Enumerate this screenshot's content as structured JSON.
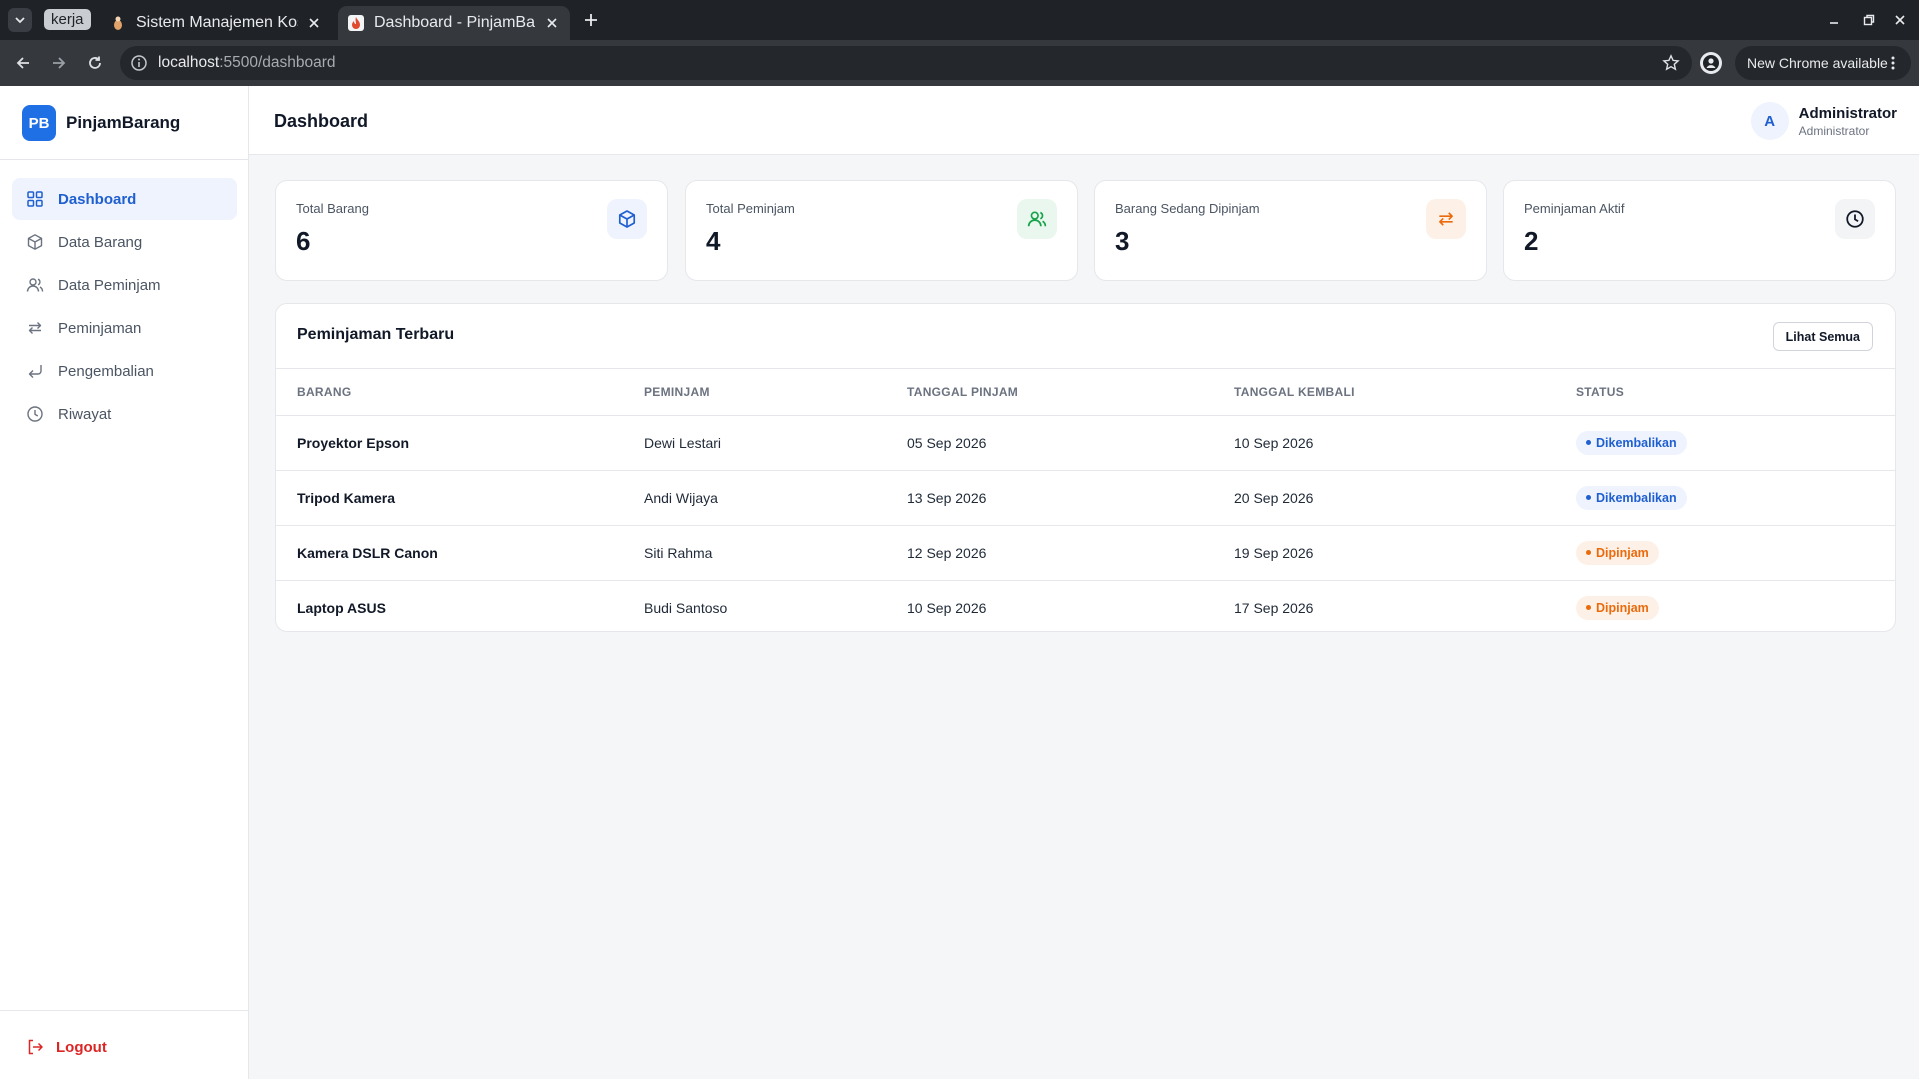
{
  "browser": {
    "group_label": "kerja",
    "tabs": [
      {
        "title": "Sistem Manajemen Kos"
      },
      {
        "title": "Dashboard - PinjamBarang"
      }
    ],
    "url_host": "localhost",
    "url_path": ":5500/dashboard",
    "update_label": "New Chrome available"
  },
  "app": {
    "logo_text": "PB",
    "name": "PinjamBarang"
  },
  "sidebar": {
    "items": [
      {
        "label": "Dashboard",
        "icon": "grid-icon",
        "active": true
      },
      {
        "label": "Data Barang",
        "icon": "box-icon"
      },
      {
        "label": "Data Peminjam",
        "icon": "users-icon"
      },
      {
        "label": "Peminjaman",
        "icon": "swap-icon"
      },
      {
        "label": "Pengembalian",
        "icon": "return-icon"
      },
      {
        "label": "Riwayat",
        "icon": "clock-icon"
      }
    ],
    "logout_label": "Logout"
  },
  "header": {
    "title": "Dashboard",
    "user_initial": "A",
    "user_name": "Administrator",
    "user_role": "Administrator"
  },
  "stats": [
    {
      "label": "Total Barang",
      "value": "6",
      "icon": "box-icon",
      "color": "#1f5fd0",
      "bg": "#eef3fd"
    },
    {
      "label": "Total Peminjam",
      "value": "4",
      "icon": "users-icon",
      "color": "#16a34a",
      "bg": "#e9f7ee"
    },
    {
      "label": "Barang Sedang Dipinjam",
      "value": "3",
      "icon": "swap-icon",
      "color": "#ea6a0c",
      "bg": "#fdf1e7"
    },
    {
      "label": "Peminjaman Aktif",
      "value": "2",
      "icon": "clock-icon",
      "color": "#111827",
      "bg": "#f3f4f6"
    }
  ],
  "recent": {
    "title": "Peminjaman Terbaru",
    "see_all_label": "Lihat Semua",
    "columns": [
      "BARANG",
      "PEMINJAM",
      "TANGGAL PINJAM",
      "TANGGAL KEMBALI",
      "STATUS"
    ],
    "rows": [
      {
        "item": "Proyektor Epson",
        "borrower": "Dewi Lestari",
        "borrow_date": "05 Sep 2026",
        "return_date": "10 Sep 2026",
        "status": "Dikembalikan"
      },
      {
        "item": "Tripod Kamera",
        "borrower": "Andi Wijaya",
        "borrow_date": "13 Sep 2026",
        "return_date": "20 Sep 2026",
        "status": "Dikembalikan"
      },
      {
        "item": "Kamera DSLR Canon",
        "borrower": "Siti Rahma",
        "borrow_date": "12 Sep 2026",
        "return_date": "19 Sep 2026",
        "status": "Dipinjam"
      },
      {
        "item": "Laptop ASUS",
        "borrower": "Budi Santoso",
        "borrow_date": "10 Sep 2026",
        "return_date": "17 Sep 2026",
        "status": "Dipinjam"
      }
    ]
  }
}
